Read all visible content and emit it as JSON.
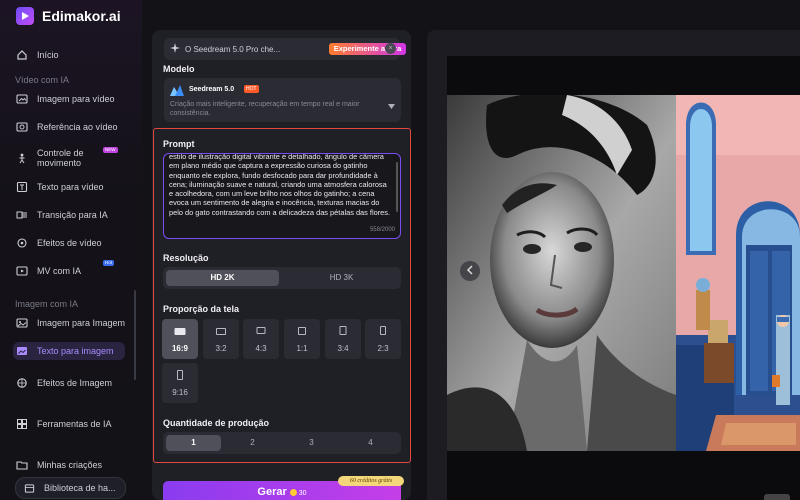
{
  "brand": {
    "name": "Edimakor.ai"
  },
  "sidebar": {
    "home": "Início",
    "section_video": "Vídeo com IA",
    "video_items": [
      {
        "label": "Imagem para vídeo",
        "icon": "image-to-video-icon"
      },
      {
        "label": "Referência ao vídeo",
        "icon": "reference-video-icon"
      },
      {
        "label": "Controle de movimento",
        "icon": "motion-control-icon",
        "badge": "NEW"
      },
      {
        "label": "Texto para vídeo",
        "icon": "text-to-video-icon"
      },
      {
        "label": "Transição para IA",
        "icon": "transition-icon"
      },
      {
        "label": "Efeitos de vídeo",
        "icon": "video-effects-icon"
      },
      {
        "label": "MV com IA",
        "icon": "mv-icon",
        "badge": "Hot"
      }
    ],
    "section_image": "Imagem com IA",
    "image_items": [
      {
        "label": "Imagem para Imagem",
        "icon": "image-to-image-icon"
      },
      {
        "label": "Texto para imagem",
        "icon": "text-to-image-icon",
        "active": true
      },
      {
        "label": "Efeitos de Imagem",
        "icon": "image-effects-icon"
      }
    ],
    "tools": "Ferramentas de IA",
    "creations": "Minhas criações",
    "library": "Biblioteca de ha..."
  },
  "banner": {
    "text": "O Seedream 5.0 Pro che...",
    "cta": "Experimente agora",
    "close": "×"
  },
  "model": {
    "section": "Modelo",
    "name": "Seedream 5.0",
    "tag": "HOT",
    "description": "Criação mais inteligente, recuperação em tempo real e maior consistência."
  },
  "prompt": {
    "section": "Prompt",
    "text": "estilo de ilustração digital vibrante e detalhado, ângulo de câmera em plano médio que captura a expressão curiosa do gatinho enquanto ele explora, fundo desfocado para dar profundidade à cena; iluminação suave e natural, criando uma atmosfera calorosa e acolhedora, com um leve brilho nos olhos do gatinho; a cena evoca um sentimento de alegria e inocência, texturas macias do pelo do gato contrastando com a delicadeza das pétalas das flores.",
    "count": "558/2000"
  },
  "resolution": {
    "section": "Resolução",
    "options": [
      "HD 2K",
      "HD 3K"
    ],
    "selected": "HD 2K"
  },
  "aspect": {
    "section": "Proporção da tela",
    "options": [
      "16:9",
      "3:2",
      "4:3",
      "1:1",
      "3:4",
      "2:3",
      "9:16"
    ],
    "selected": "16:9"
  },
  "quantity": {
    "section": "Quantidade de produção",
    "options": [
      "1",
      "2",
      "3",
      "4"
    ],
    "selected": "1"
  },
  "generate": {
    "label": "Gerar",
    "cost": "30",
    "credits_tag": "60 créditos grátis"
  },
  "colors": {
    "accent": "#8a3cf0",
    "highlight_frame": "#e2483f",
    "active_nav": "#a88bff"
  }
}
